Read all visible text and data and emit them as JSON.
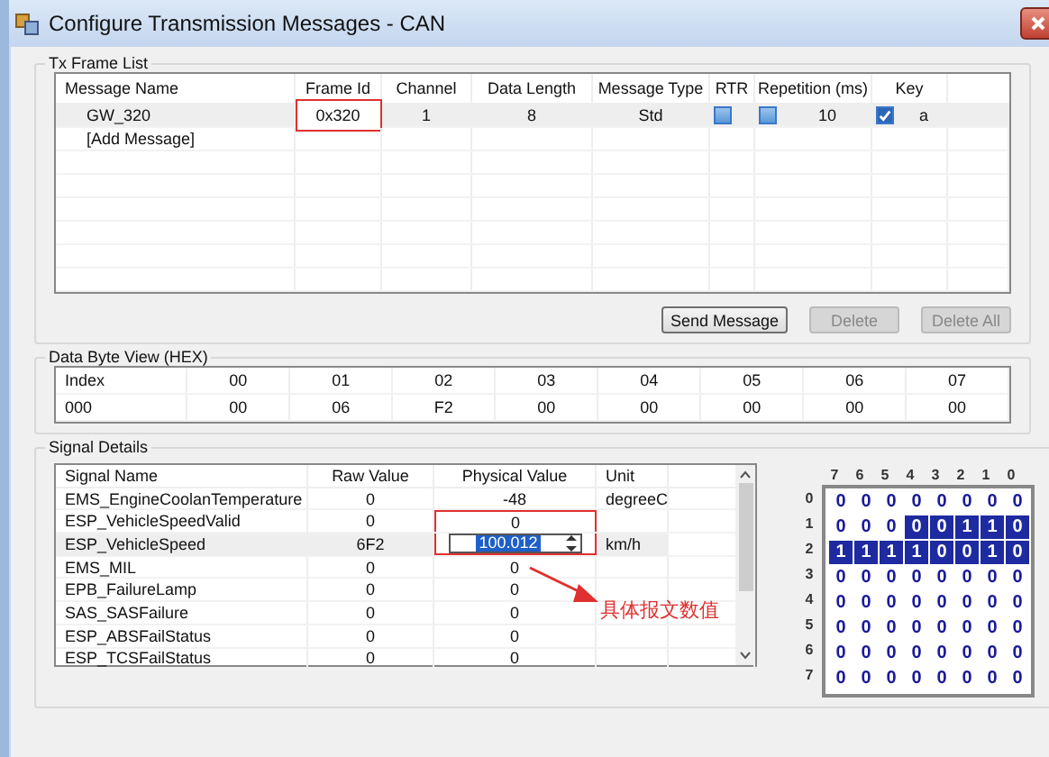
{
  "window": {
    "title": "Configure Transmission Messages - CAN"
  },
  "tx_frame_list": {
    "title": "Tx Frame List",
    "columns": [
      "Message Name",
      "Frame Id",
      "Channel",
      "Data Length",
      "Message Type",
      "RTR",
      "Repetition (ms)",
      "Key"
    ],
    "rows": [
      {
        "message_name": "GW_320",
        "frame_id": "0x320",
        "frame_id_highlighted": true,
        "channel": "1",
        "data_length": "8",
        "message_type": "Std",
        "rtr_checked": false,
        "repetition_checked": false,
        "repetition": "10",
        "key_checked": true,
        "key": "a"
      }
    ],
    "add_row": "[Add Message]",
    "buttons": [
      {
        "label": "Send Message",
        "disabled": false
      },
      {
        "label": "Delete",
        "disabled": true
      },
      {
        "label": "Delete All",
        "disabled": true
      }
    ]
  },
  "data_byte_view": {
    "title": "Data Byte View (HEX)",
    "columns": [
      "Index",
      "00",
      "01",
      "02",
      "03",
      "04",
      "05",
      "06",
      "07"
    ],
    "rows": [
      [
        "000",
        "00",
        "06",
        "F2",
        "00",
        "00",
        "00",
        "00",
        "00"
      ]
    ]
  },
  "signal_details": {
    "title": "Signal Details",
    "columns": [
      "Signal Name",
      "Raw Value",
      "Physical Value",
      "Unit"
    ],
    "rows": [
      {
        "name": "EMS_EngineCoolanTemperature",
        "raw": "0",
        "physical": "-48",
        "unit": "degreeC",
        "editing": false,
        "boxed": false
      },
      {
        "name": "ESP_VehicleSpeedValid",
        "raw": "0",
        "physical": "0",
        "unit": "",
        "editing": false,
        "boxed": true
      },
      {
        "name": "ESP_VehicleSpeed",
        "raw": "6F2",
        "physical": "100.012",
        "unit": "km/h",
        "editing": true,
        "boxed": true
      },
      {
        "name": "EMS_MIL",
        "raw": "0",
        "physical": "0",
        "unit": "",
        "editing": false,
        "boxed": false
      },
      {
        "name": "EPB_FailureLamp",
        "raw": "0",
        "physical": "0",
        "unit": "",
        "editing": false,
        "boxed": false
      },
      {
        "name": "SAS_SASFailure",
        "raw": "0",
        "physical": "0",
        "unit": "",
        "editing": false,
        "boxed": false
      },
      {
        "name": "ESP_ABSFailStatus",
        "raw": "0",
        "physical": "0",
        "unit": "",
        "editing": false,
        "boxed": false
      },
      {
        "name": "ESP_TCSFailStatus",
        "raw": "0",
        "physical": "0",
        "unit": "",
        "editing": false,
        "boxed": false
      }
    ],
    "callout": "具体报文数值",
    "bit_grid": {
      "bit_labels": [
        "7",
        "6",
        "5",
        "4",
        "3",
        "2",
        "1",
        "0"
      ],
      "rows": [
        {
          "label": "0",
          "cells": [
            {
              "value": "0",
              "selected": false
            },
            {
              "value": "0",
              "selected": false
            },
            {
              "value": "0",
              "selected": false
            },
            {
              "value": "0",
              "selected": false
            },
            {
              "value": "0",
              "selected": false
            },
            {
              "value": "0",
              "selected": false
            },
            {
              "value": "0",
              "selected": false
            },
            {
              "value": "0",
              "selected": false
            }
          ]
        },
        {
          "label": "1",
          "cells": [
            {
              "value": "0",
              "selected": false
            },
            {
              "value": "0",
              "selected": false
            },
            {
              "value": "0",
              "selected": false
            },
            {
              "value": "0",
              "selected": true
            },
            {
              "value": "0",
              "selected": true
            },
            {
              "value": "1",
              "selected": true
            },
            {
              "value": "1",
              "selected": true
            },
            {
              "value": "0",
              "selected": true
            }
          ]
        },
        {
          "label": "2",
          "cells": [
            {
              "value": "1",
              "selected": true
            },
            {
              "value": "1",
              "selected": true
            },
            {
              "value": "1",
              "selected": true
            },
            {
              "value": "1",
              "selected": true
            },
            {
              "value": "0",
              "selected": true
            },
            {
              "value": "0",
              "selected": true
            },
            {
              "value": "1",
              "selected": true
            },
            {
              "value": "0",
              "selected": true
            }
          ]
        },
        {
          "label": "3",
          "cells": [
            {
              "value": "0",
              "selected": false
            },
            {
              "value": "0",
              "selected": false
            },
            {
              "value": "0",
              "selected": false
            },
            {
              "value": "0",
              "selected": false
            },
            {
              "value": "0",
              "selected": false
            },
            {
              "value": "0",
              "selected": false
            },
            {
              "value": "0",
              "selected": false
            },
            {
              "value": "0",
              "selected": false
            }
          ]
        },
        {
          "label": "4",
          "cells": [
            {
              "value": "0",
              "selected": false
            },
            {
              "value": "0",
              "selected": false
            },
            {
              "value": "0",
              "selected": false
            },
            {
              "value": "0",
              "selected": false
            },
            {
              "value": "0",
              "selected": false
            },
            {
              "value": "0",
              "selected": false
            },
            {
              "value": "0",
              "selected": false
            },
            {
              "value": "0",
              "selected": false
            }
          ]
        },
        {
          "label": "5",
          "cells": [
            {
              "value": "0",
              "selected": false
            },
            {
              "value": "0",
              "selected": false
            },
            {
              "value": "0",
              "selected": false
            },
            {
              "value": "0",
              "selected": false
            },
            {
              "value": "0",
              "selected": false
            },
            {
              "value": "0",
              "selected": false
            },
            {
              "value": "0",
              "selected": false
            },
            {
              "value": "0",
              "selected": false
            }
          ]
        },
        {
          "label": "6",
          "cells": [
            {
              "value": "0",
              "selected": false
            },
            {
              "value": "0",
              "selected": false
            },
            {
              "value": "0",
              "selected": false
            },
            {
              "value": "0",
              "selected": false
            },
            {
              "value": "0",
              "selected": false
            },
            {
              "value": "0",
              "selected": false
            },
            {
              "value": "0",
              "selected": false
            },
            {
              "value": "0",
              "selected": false
            }
          ]
        },
        {
          "label": "7",
          "cells": [
            {
              "value": "0",
              "selected": false
            },
            {
              "value": "0",
              "selected": false
            },
            {
              "value": "0",
              "selected": false
            },
            {
              "value": "0",
              "selected": false
            },
            {
              "value": "0",
              "selected": false
            },
            {
              "value": "0",
              "selected": false
            },
            {
              "value": "0",
              "selected": false
            },
            {
              "value": "0",
              "selected": false
            }
          ]
        }
      ]
    }
  }
}
